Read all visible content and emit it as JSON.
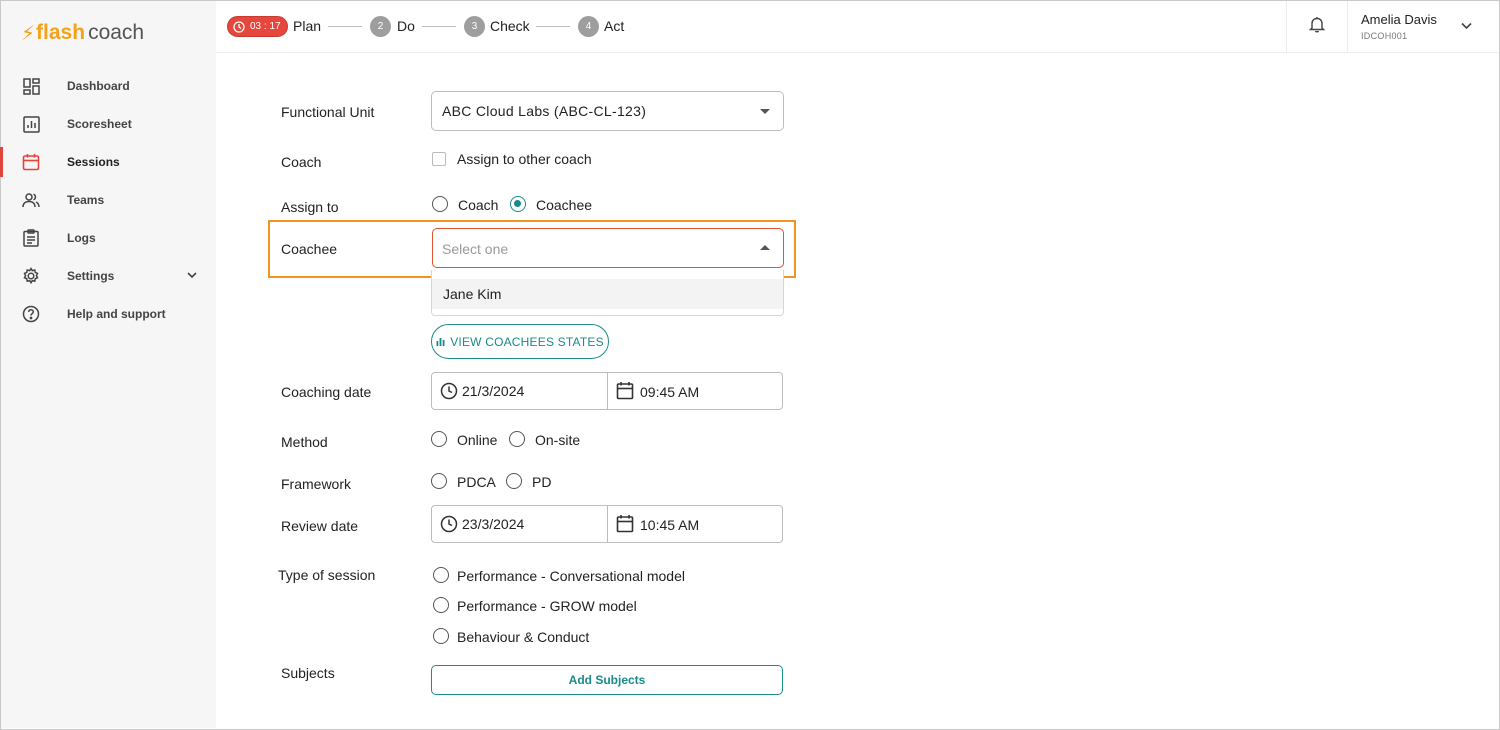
{
  "app": {
    "logo_flash": "flash",
    "logo_coach": "coach",
    "brand_color": "#f5a21b",
    "accent_color": "#1a8a8a"
  },
  "sidebar": {
    "items": [
      {
        "label": "Dashboard",
        "icon": "dashboard-icon"
      },
      {
        "label": "Scoresheet",
        "icon": "chart-icon"
      },
      {
        "label": "Sessions",
        "icon": "calendar-icon",
        "active": true
      },
      {
        "label": "Teams",
        "icon": "users-icon"
      },
      {
        "label": "Logs",
        "icon": "clipboard-icon"
      },
      {
        "label": "Settings",
        "icon": "gear-icon",
        "expandable": true
      },
      {
        "label": "Help and support",
        "icon": "help-icon"
      }
    ]
  },
  "topbar": {
    "timer": "03 : 17",
    "steps": [
      {
        "num": "",
        "label": "Plan"
      },
      {
        "num": "2",
        "label": "Do"
      },
      {
        "num": "3",
        "label": "Check"
      },
      {
        "num": "4",
        "label": "Act"
      }
    ],
    "user": {
      "name": "Amelia Davis",
      "id": "IDCOH001"
    }
  },
  "form": {
    "functional_unit": {
      "label": "Functional Unit",
      "value": "ABC Cloud Labs (ABC-CL-123)"
    },
    "coach": {
      "label": "Coach",
      "checkbox_label": "Assign to other coach",
      "checked": false
    },
    "assign_to": {
      "label": "Assign to",
      "options": [
        "Coach",
        "Coachee"
      ],
      "selected": "Coachee"
    },
    "coachee": {
      "label": "Coachee",
      "placeholder": "Select one",
      "options": [
        "Jane Kim"
      ]
    },
    "view_states_button": "VIEW COACHEES STATES",
    "coaching_date": {
      "label": "Coaching date",
      "date": "21/3/2024",
      "time": "09:45 AM"
    },
    "method": {
      "label": "Method",
      "options": [
        "Online",
        "On-site"
      ]
    },
    "framework": {
      "label": "Framework",
      "options": [
        "PDCA",
        "PD"
      ]
    },
    "review_date": {
      "label": "Review date",
      "date": "23/3/2024",
      "time": "10:45 AM"
    },
    "session_type": {
      "label": "Type of session",
      "options": [
        "Performance - Conversational model",
        "Performance - GROW model",
        "Behaviour & Conduct"
      ]
    },
    "subjects": {
      "label": "Subjects",
      "button": "Add Subjects"
    }
  }
}
